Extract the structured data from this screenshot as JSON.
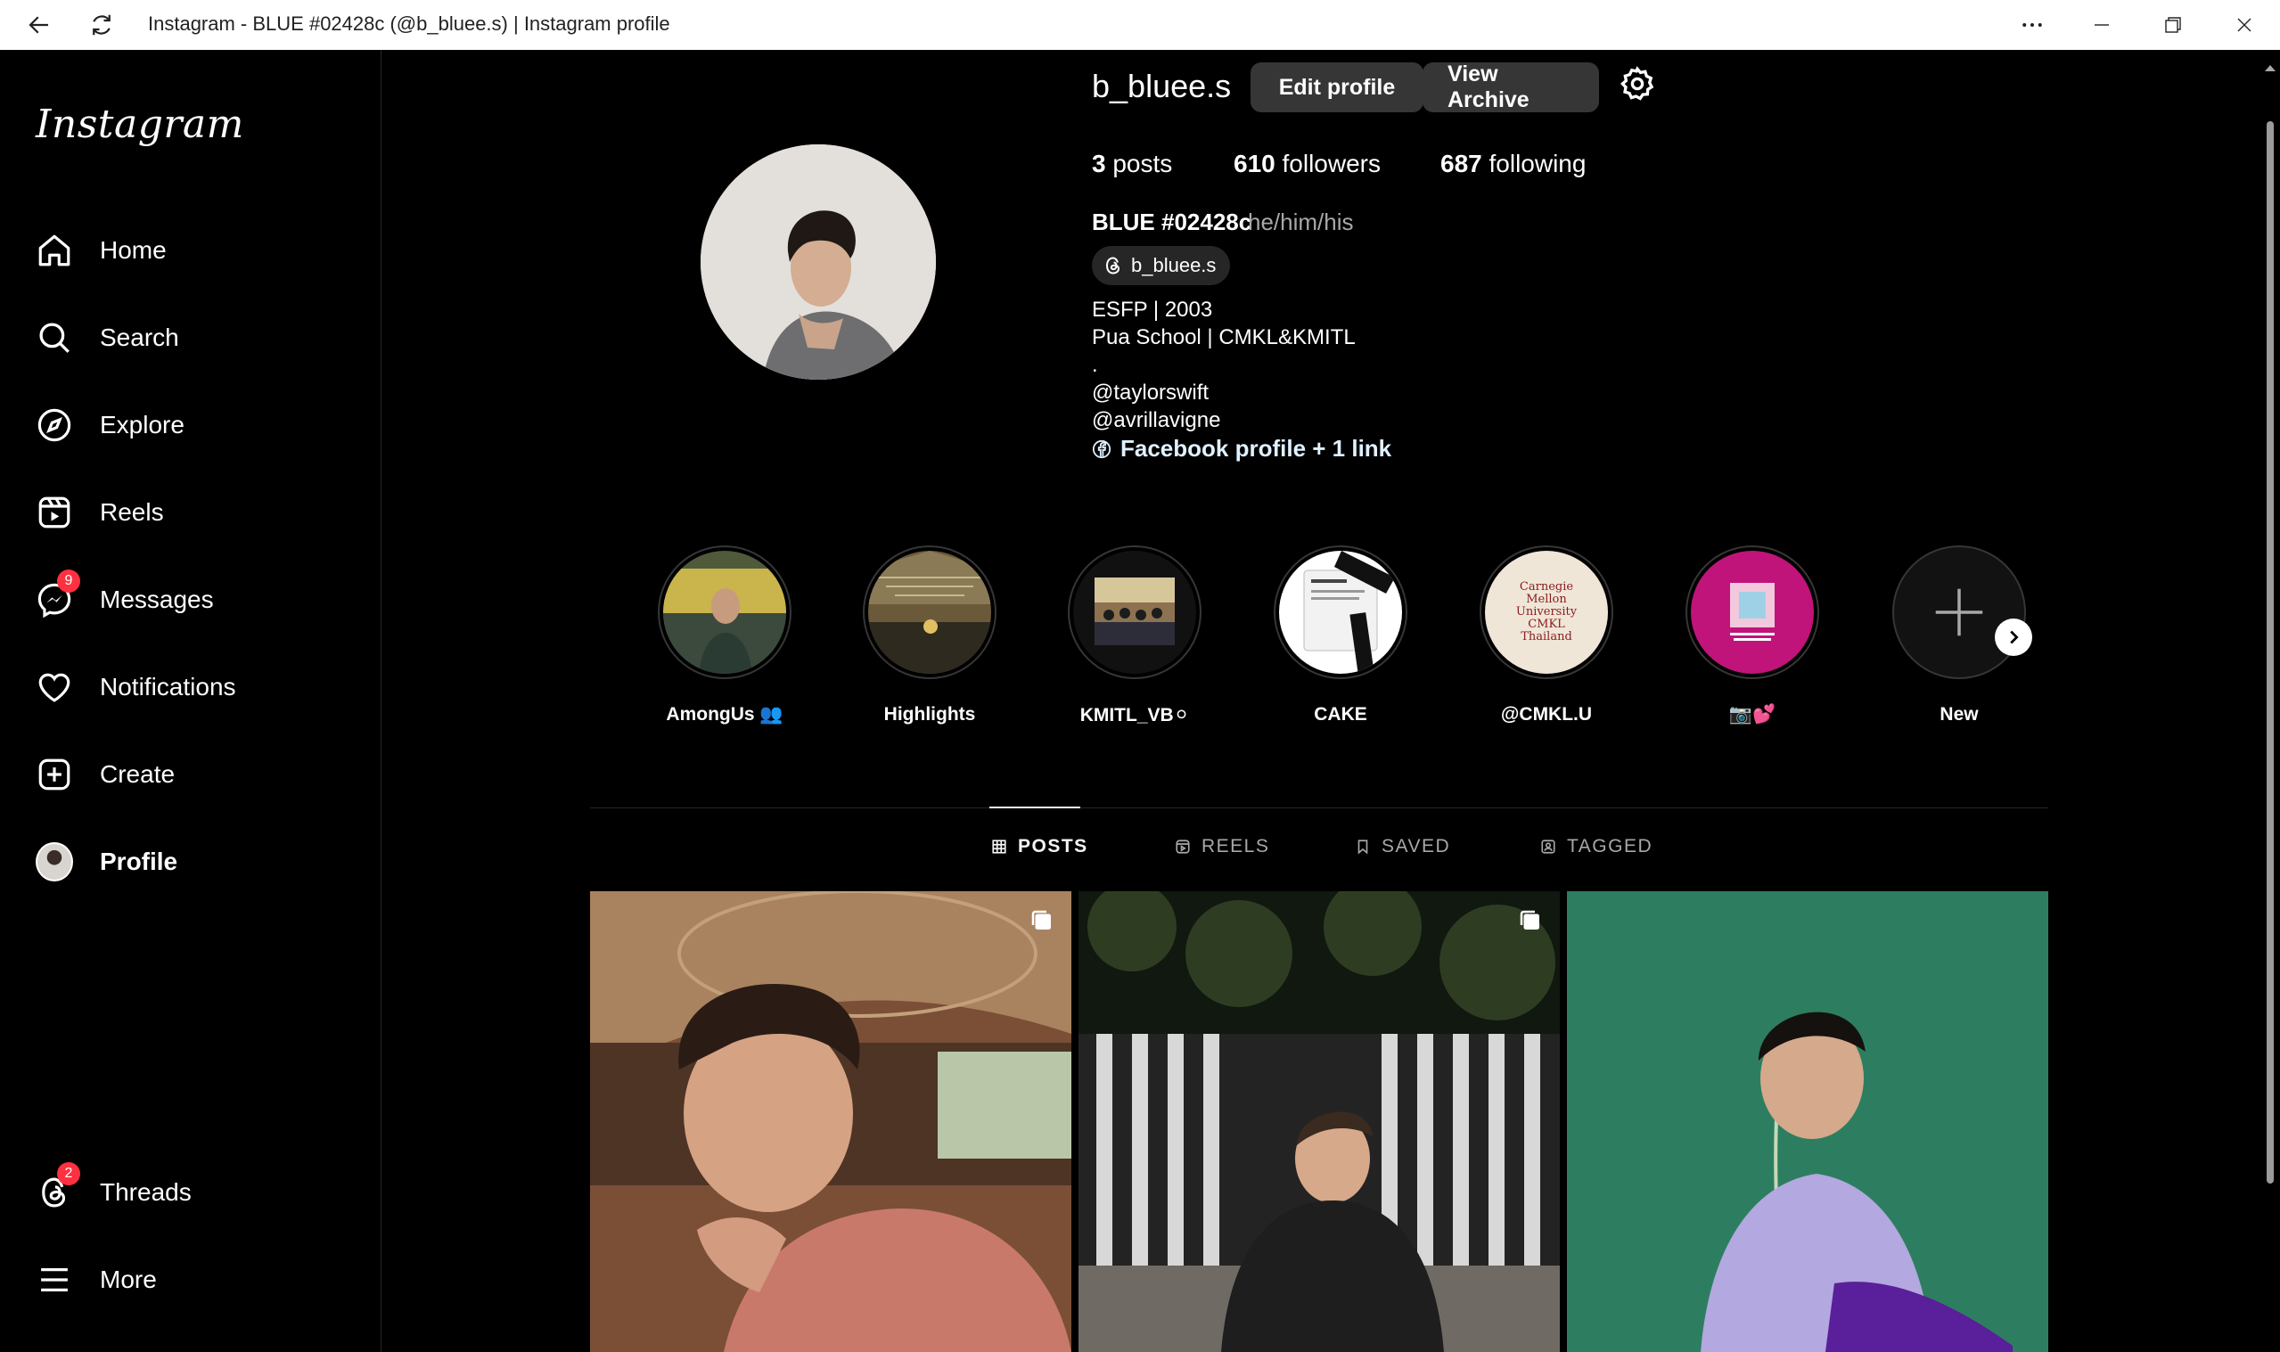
{
  "window": {
    "title": "Instagram - BLUE #02428c (@b_bluee.s) | Instagram profile"
  },
  "sidebar": {
    "logo": "Instagram",
    "items": [
      {
        "label": "Home",
        "icon": "home-icon"
      },
      {
        "label": "Search",
        "icon": "search-icon"
      },
      {
        "label": "Explore",
        "icon": "compass-icon"
      },
      {
        "label": "Reels",
        "icon": "reels-icon"
      },
      {
        "label": "Messages",
        "icon": "messenger-icon",
        "badge": "9"
      },
      {
        "label": "Notifications",
        "icon": "heart-icon"
      },
      {
        "label": "Create",
        "icon": "plus-square-icon"
      },
      {
        "label": "Profile",
        "icon": "avatar"
      },
      {
        "label": "Threads",
        "icon": "threads-icon",
        "badge": "2"
      },
      {
        "label": "More",
        "icon": "menu-icon"
      }
    ]
  },
  "profile": {
    "username": "b_bluee.s",
    "edit_label": "Edit profile",
    "archive_label": "View Archive",
    "stats": {
      "posts_count": "3",
      "posts_label": "posts",
      "followers_count": "610",
      "followers_label": "followers",
      "following_count": "687",
      "following_label": "following"
    },
    "full_name": "BLUE #02428c",
    "pronouns": "he/him/his",
    "threads_handle": "b_bluee.s",
    "bio": [
      "ESFP | 2003",
      "Pua School | CMKL&KMITL",
      ".",
      "@taylorswift",
      "@avrillavigne"
    ],
    "link_text": "Facebook profile + 1 link"
  },
  "highlights": [
    {
      "label": "AmongUs 👥"
    },
    {
      "label": "Highlights"
    },
    {
      "label": "KMITL_VB⚪"
    },
    {
      "label": "CAKE"
    },
    {
      "label": "@CMKL.U",
      "image_text": "Carnegie Mellon University CMKL Thailand"
    },
    {
      "label": "📷💕"
    },
    {
      "label": "New"
    }
  ],
  "tabs": [
    {
      "label": "POSTS",
      "active": true
    },
    {
      "label": "REELS",
      "active": false
    },
    {
      "label": "SAVED",
      "active": false
    },
    {
      "label": "TAGGED",
      "active": false
    }
  ],
  "colors": {
    "background": "#000000",
    "button_bg": "#363636",
    "badge_red": "#ff3040",
    "muted_text": "#a8a8a8",
    "link_text": "#e0f1ff"
  }
}
